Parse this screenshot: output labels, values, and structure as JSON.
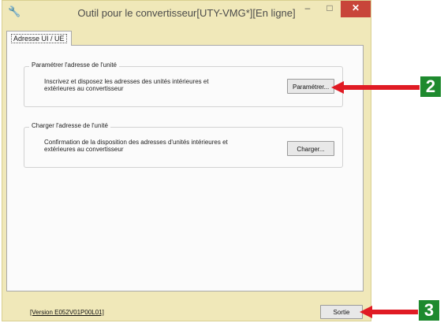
{
  "window": {
    "title": "Outil pour le convertisseur[UTY-VMG*][En ligne]",
    "controls": {
      "minimize": "–",
      "maximize": "□",
      "close": "✕"
    }
  },
  "tab": {
    "label": "Adresse UI / UE"
  },
  "groups": [
    {
      "label": "Paramétrer l'adresse de l'unité",
      "description": "Inscrivez et disposez les adresses des unités intérieures et extérieures au convertisseur",
      "button": "Paramétrer..."
    },
    {
      "label": "Charger l'adresse de l'unité",
      "description": "Confirmation de la disposition des adresses d'unités intérieures et extérieures au convertisseur",
      "button": "Charger..."
    }
  ],
  "footer": {
    "version": "[Version E052V01P00L01]",
    "exit_button": "Sortie"
  },
  "callouts": {
    "c2": "2",
    "c3": "3"
  },
  "colors": {
    "window_bg": "#f0e8b9",
    "close_button": "#c8453a",
    "arrow": "#e01b24",
    "callout": "#1e8a2e"
  },
  "icons": {
    "app": "wrench-icon"
  }
}
